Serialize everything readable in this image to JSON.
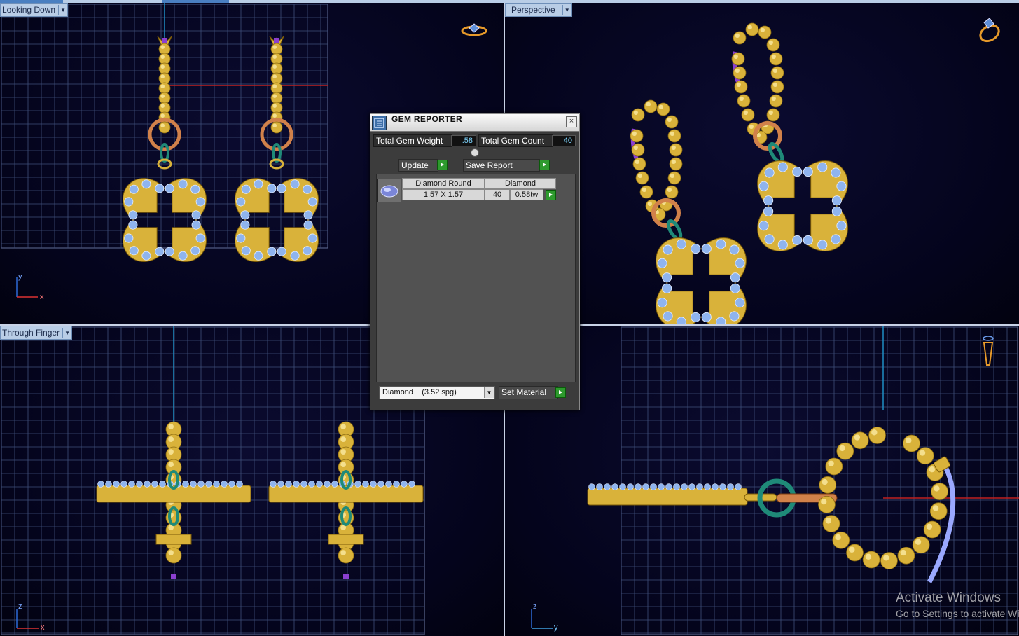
{
  "viewports": {
    "top_left": {
      "label": "Looking Down",
      "axis_v": "y",
      "axis_h": "x"
    },
    "top_right": {
      "label": "Perspective"
    },
    "bottom_left": {
      "label": "Through Finger",
      "axis_v": "z",
      "axis_h": "x"
    },
    "bottom_right": {
      "axis_v": "z",
      "axis_h": "y"
    }
  },
  "gem_reporter": {
    "title": "GEM REPORTER",
    "close_glyph": "×",
    "total_weight_label": "Total Gem Weight",
    "total_weight_value": ".58",
    "total_count_label": "Total Gem Count",
    "total_count_value": "40",
    "update_label": "Update",
    "save_report_label": "Save Report",
    "rows": [
      {
        "cut": "Diamond Round",
        "size": "1.57 X 1.57",
        "material": "Diamond",
        "count": "40",
        "weight": "0.58tw"
      }
    ],
    "material_select": "Diamond    (3.52 spg)",
    "set_material_label": "Set Material"
  },
  "watermark": {
    "line1": "Activate Windows",
    "line2": "Go to Settings to activate Windows."
  },
  "colors": {
    "gold": "#d9b23a",
    "stone": "#8fb4ee",
    "grid": "#3f4f7a",
    "teal": "#1f8a78",
    "copper": "#d1814a",
    "purple": "#8b3fd0"
  }
}
